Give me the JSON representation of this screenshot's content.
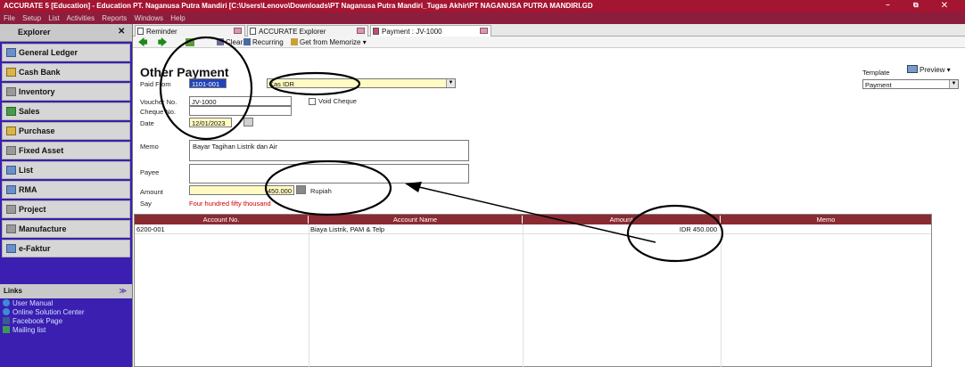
{
  "app": {
    "title": "ACCURATE 5 [Education] - Education  PT. Naganusa Putra Mandiri  [C:\\Users\\Lenovo\\Downloads\\PT Naganusa Putra Mandiri_Tugas Akhir\\PT NAGANUSA PUTRA MANDIRI.GD",
    "window_controls": "– ⧉ ✕",
    "menu": [
      "File",
      "Setup",
      "List",
      "Activities",
      "Reports",
      "Windows",
      "Help"
    ]
  },
  "explorer": {
    "title": "Explorer",
    "close": "✕",
    "items": [
      "General Ledger",
      "Cash Bank",
      "Inventory",
      "Sales",
      "Purchase",
      "Fixed Asset",
      "List",
      "RMA",
      "Project",
      "Manufacture",
      "e-Faktur"
    ],
    "links_title": "Links",
    "links_chevron": "≫",
    "links": [
      "User Manual",
      "Online Solution Center",
      "Facebook Page",
      "Mailing list"
    ]
  },
  "tabs": [
    "Reminder",
    "ACCURATE Explorer",
    "Payment : JV-1000"
  ],
  "toolbar": {
    "back": "🡄",
    "forward": "🡆",
    "clear": "Clear",
    "recurring": "Recurring",
    "memorize": "Get from Memorize"
  },
  "form": {
    "title": "Other Payment",
    "paid_from_label": "Paid From",
    "paid_from_code": "1101-001",
    "paid_from_name": "Kas IDR",
    "voucher_label": "Voucher No.",
    "voucher_value": "JV-1000",
    "void_label": "Void Cheque",
    "cheque_label": "Cheque No.",
    "cheque_value": "",
    "date_label": "Date",
    "date_value": "12/01/2023",
    "memo_label": "Memo",
    "memo_value": "Bayar Tagihan Listrik dan Air",
    "payee_label": "Payee",
    "payee_value": "",
    "amount_label": "Amount",
    "amount_value": "450.000",
    "currency": "Rupiah",
    "say_label": "Say",
    "say_value": "Four hundred fifty thousand",
    "template_label": "Template",
    "preview_label": "Preview",
    "template_value": "Payment"
  },
  "grid": {
    "headers": [
      "Account No.",
      "Account Name",
      "Amount",
      "Memo"
    ],
    "rows": [
      {
        "account_no": "6200-001",
        "account_name": "Biaya Listrik, PAM & Telp",
        "amount": "IDR 450.000",
        "memo": ""
      }
    ]
  }
}
